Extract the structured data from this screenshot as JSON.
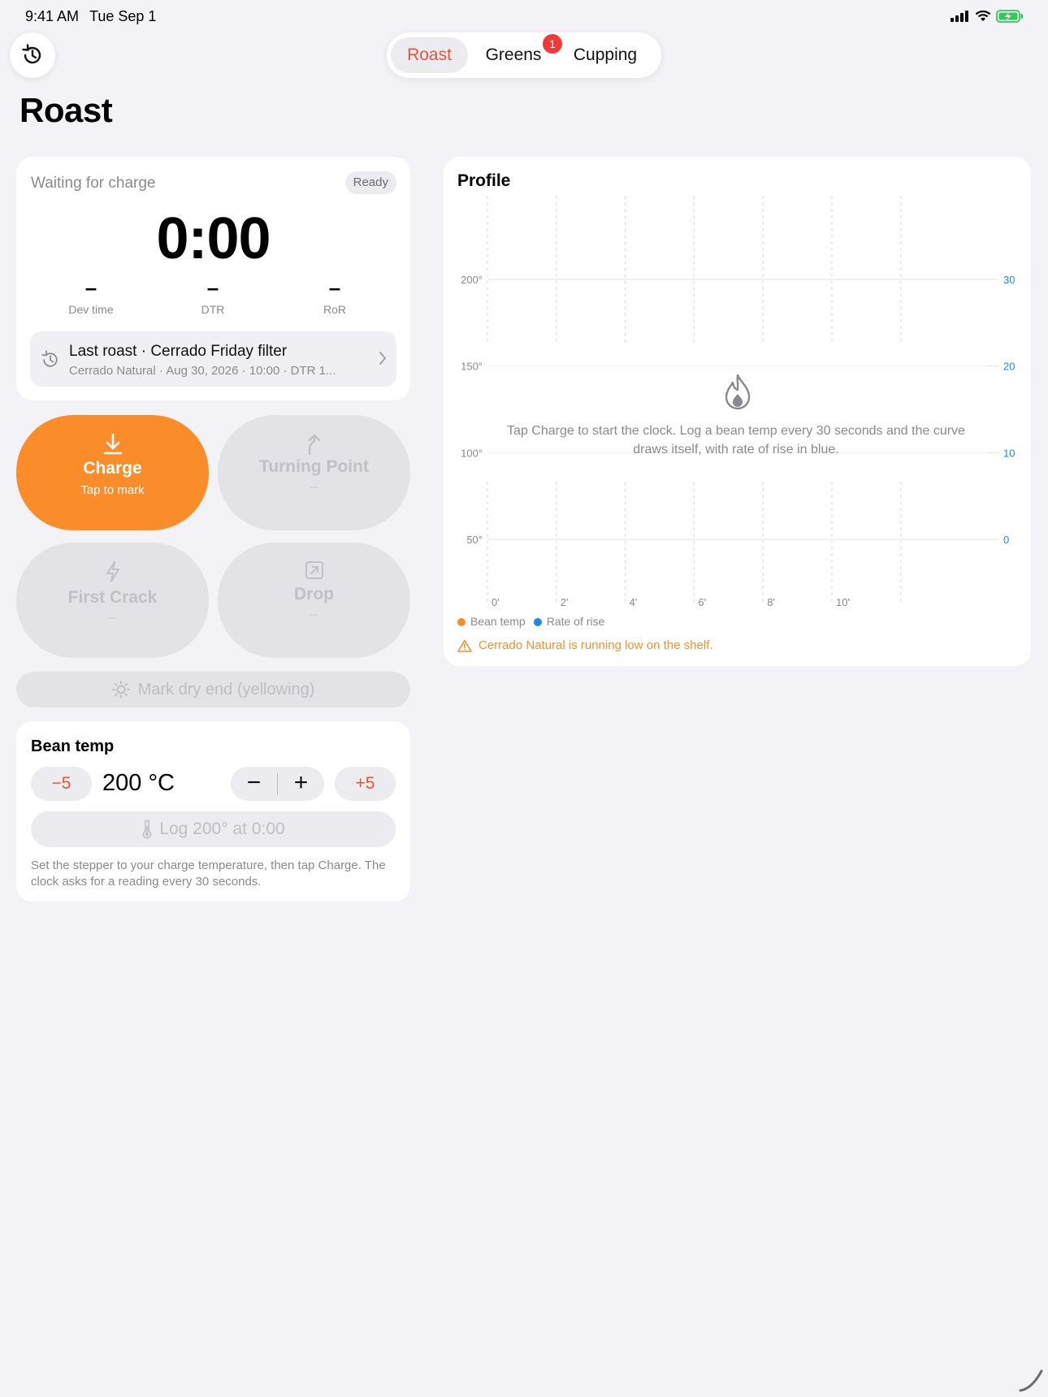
{
  "status_bar": {
    "time": "9:41 AM",
    "date": "Tue Sep 1"
  },
  "nav": {
    "history_icon": "clock-arrow-icon",
    "tabs": [
      {
        "label": "Roast",
        "selected": true
      },
      {
        "label": "Greens",
        "badge": "1"
      },
      {
        "label": "Cupping"
      }
    ]
  },
  "page_title": "Roast",
  "timer_card": {
    "status": "Waiting for charge",
    "state_badge": "Ready",
    "timer": "0:00",
    "metrics": [
      {
        "value": "–",
        "label": "Dev time"
      },
      {
        "value": "–",
        "label": "DTR"
      },
      {
        "value": "–",
        "label": "RoR"
      }
    ],
    "last_roast": {
      "title": "Last roast · Cerrado Friday filter",
      "subtitle": "Cerrado Natural · Aug 30, 2026 · 10:00 · DTR 1..."
    }
  },
  "actions": {
    "charge": {
      "label": "Charge",
      "sub": "Tap to mark"
    },
    "turning_point": {
      "label": "Turning Point",
      "sub": "–"
    },
    "first_crack": {
      "label": "First Crack",
      "sub": "–"
    },
    "drop": {
      "label": "Drop",
      "sub": "–"
    },
    "dry_end": "Mark dry end (yellowing)"
  },
  "bean_temp": {
    "title": "Bean temp",
    "minus5": "−5",
    "plus5": "+5",
    "value": "200 °C",
    "stepper_minus": "−",
    "stepper_plus": "+",
    "log_label": "Log 200° at 0:00",
    "help": "Set the stepper to your charge temperature, then tap Charge. The clock asks for a reading every 30 seconds."
  },
  "profile": {
    "title": "Profile",
    "empty_message": "Tap Charge to start the clock. Log a bean temp every 30 seconds and the curve draws itself, with rate of rise in blue.",
    "legend": [
      "Bean temp",
      "Rate of rise"
    ],
    "warning": "Cerrado Natural is running low on the shelf."
  },
  "colors": {
    "accent": "#fb8c2a",
    "red": "#e5533d",
    "blue": "#1a8ae6",
    "warning": "#f0912d"
  },
  "chart_data": {
    "type": "line",
    "x_ticks": [
      "0'",
      "2'",
      "4'",
      "6'",
      "8'",
      "10'"
    ],
    "y_left_ticks": [
      "200°",
      "150°",
      "100°",
      "50°"
    ],
    "y_right_ticks": [
      "30",
      "20",
      "10",
      "0"
    ],
    "y_left_values": [
      200,
      150,
      100,
      50
    ],
    "y_right_values": [
      30,
      20,
      10,
      0
    ],
    "x_values": [
      0,
      2,
      4,
      6,
      8,
      10
    ],
    "series": [
      {
        "name": "Bean temp",
        "color": "#fb8c2a",
        "values": []
      },
      {
        "name": "Rate of rise",
        "color": "#1a8ae6",
        "values": []
      }
    ]
  }
}
